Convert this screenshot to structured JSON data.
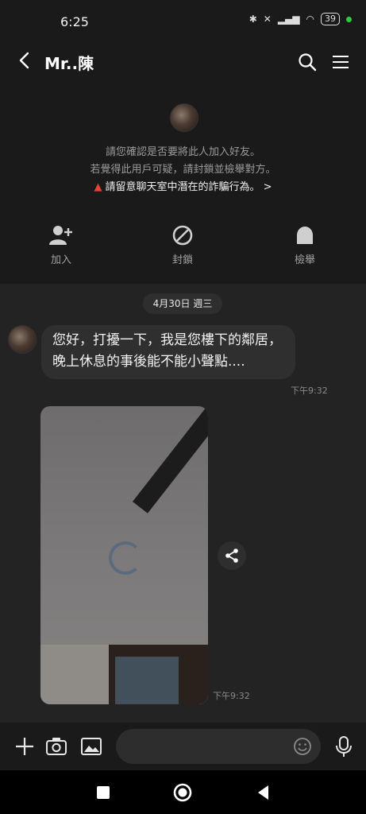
{
  "status_bar": {
    "time": "6:25",
    "battery": "39"
  },
  "header": {
    "title": "Mr..陳"
  },
  "notice": {
    "line1": "請您確認是否要將此人加入好友。",
    "line2": "若覺得此用戶可疑，請封鎖並檢舉對方。",
    "warning": "請留意聊天室中潛在的詐騙行為。",
    "warning_arrow": ">"
  },
  "actions": {
    "add_label": "加入",
    "block_label": "封鎖",
    "report_label": "檢舉"
  },
  "chat": {
    "date_chip": "4月30日 週三",
    "message1": {
      "text": "您好，打擾一下，我是您樓下的鄰居，晚上休息的事後能不能小聲點....",
      "time": "下午9:32"
    },
    "message2": {
      "time": "下午9:32"
    }
  },
  "composer": {
    "input_value": ""
  },
  "colors": {
    "background": "#1f1f1f",
    "chat_background": "#232323",
    "bubble": "#2f2f2f",
    "warning_red": "#e0453a",
    "online_dot": "#2ecc40"
  }
}
